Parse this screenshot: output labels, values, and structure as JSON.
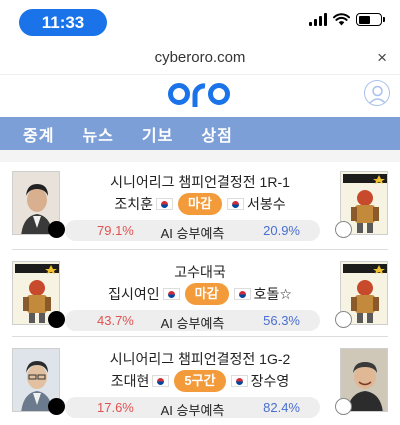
{
  "status": {
    "time": "11:33"
  },
  "browser": {
    "url": "cyberoro.com",
    "close": "×"
  },
  "site": {
    "logo": "oro"
  },
  "nav": [
    "중계",
    "뉴스",
    "기보",
    "상점"
  ],
  "matches": [
    {
      "title": "시니어리그 챔피언결정전 1R-1",
      "black": "조치훈",
      "white": "서봉수",
      "status": "마감",
      "black_pct": "79.1%",
      "label": "AI 승부예측",
      "white_pct": "20.9%"
    },
    {
      "title": "고수대국",
      "black": "집시여인",
      "white": "호돌☆",
      "status": "마감",
      "black_pct": "43.7%",
      "label": "AI 승부예측",
      "white_pct": "56.3%"
    },
    {
      "title": "시니어리그 챔피언결정전 1G-2",
      "black": "조대현",
      "white": "장수영",
      "status": "5구간",
      "black_pct": "17.6%",
      "label": "AI 승부예측",
      "white_pct": "82.4%"
    }
  ],
  "colors": {
    "nav": "#7d9fd8",
    "accent": "#1a73e8",
    "badge": "#f39a3a",
    "black_pct": "#e05252",
    "white_pct": "#4a6fd0"
  },
  "icons": [
    "signal-icon",
    "wifi-icon",
    "battery-icon",
    "close-icon",
    "user-icon",
    "korea-flag-icon",
    "black-stone-icon",
    "white-stone-icon"
  ]
}
